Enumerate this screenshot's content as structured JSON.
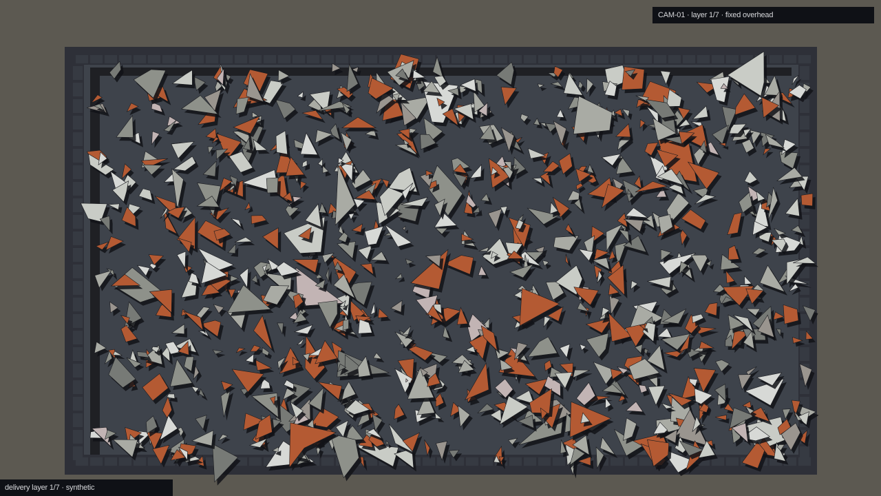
{
  "overlay": {
    "camera_caption": "CAM-01 · layer 1/7 · fixed overhead",
    "footer_caption": "delivery layer 1/7 · synthetic"
  },
  "scene": {
    "background_color": "#5c5951",
    "tray_frame_color": "#2e3038",
    "tray_floor_color": "#3e434b",
    "tray_slat_color": "#363a42",
    "rail_color": "#1f2024",
    "shard_colors": [
      "#b45a33",
      "#a9aba4",
      "#8e918a",
      "#c9ccc6",
      "#d7d9d6",
      "#777a76",
      "#9a958f",
      "#c2b4b4"
    ]
  }
}
